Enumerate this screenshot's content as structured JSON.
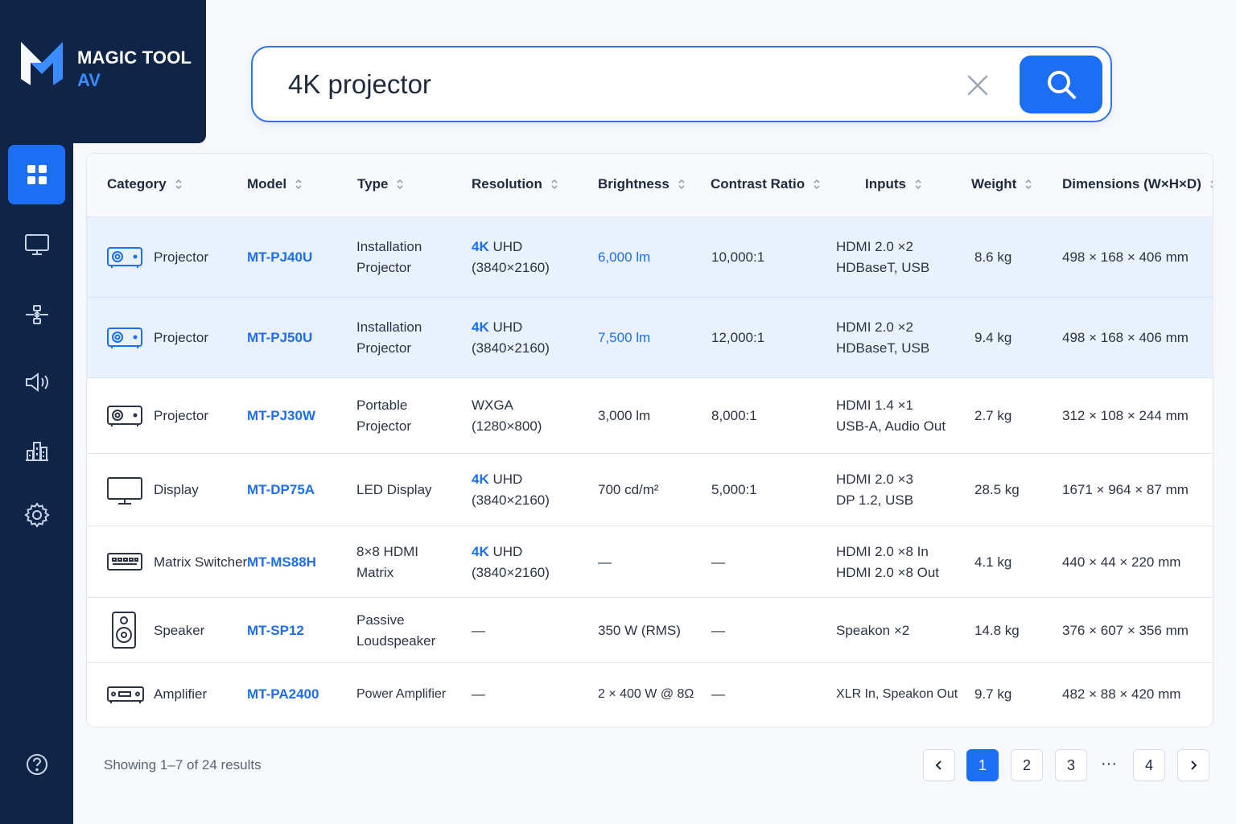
{
  "brand": {
    "name": "MAGIC TOOL",
    "sub": "AV",
    "logo_icon": "m-logo-icon",
    "accent": "#3b8cff",
    "bg": "#0f2548"
  },
  "sidebar": {
    "items": [
      {
        "name": "dashboard-icon",
        "active": true
      },
      {
        "name": "monitor-icon",
        "active": false
      },
      {
        "name": "network-icon",
        "active": false
      },
      {
        "name": "speaker-volume-icon",
        "active": false
      },
      {
        "name": "building-icon",
        "active": false
      },
      {
        "name": "settings-gear-icon",
        "active": false
      }
    ],
    "help_icon": "help-icon"
  },
  "search": {
    "value": "4K projector",
    "clear_icon": "close-icon",
    "button_icon": "search-icon",
    "accent": "#1c6ef2"
  },
  "table": {
    "columns": [
      "Category",
      "Model",
      "Type",
      "Resolution",
      "Brightness",
      "Contrast Ratio",
      "Inputs",
      "Weight",
      "Dimensions (W×H×D)"
    ],
    "rows": [
      {
        "icon": "projector-icon",
        "category": "Projector",
        "model": "MT-PJ40U",
        "type": [
          "Installation",
          "Projector"
        ],
        "res_prefix": "4K",
        "res_1": "UHD",
        "res_2": "(3840×2160)",
        "brightness": "6,000 lm",
        "contrast": "10,000:1",
        "inputs": [
          "HDMI 2.0 ×2",
          "HDBaseT, USB"
        ],
        "weight": "8.6 kg",
        "dimensions": "498 × 168 × 406 mm",
        "highlighted": true
      },
      {
        "icon": "projector-icon",
        "category": "Projector",
        "model": "MT-PJ50U",
        "type": [
          "Installation",
          "Projector"
        ],
        "res_prefix": "4K",
        "res_1": "UHD",
        "res_2": "(3840×2160)",
        "brightness": "7,500 lm",
        "contrast": "12,000:1",
        "inputs": [
          "HDMI 2.0 ×2",
          "HDBaseT, USB"
        ],
        "weight": "9.4 kg",
        "dimensions": "498 × 168 × 406 mm",
        "highlighted": true
      },
      {
        "icon": "projector-icon",
        "category": "Projector",
        "model": "MT-PJ30W",
        "type": [
          "Portable",
          "Projector"
        ],
        "res_prefix": "",
        "res_1": "WXGA",
        "res_2": "(1280×800)",
        "brightness": "3,000 lm",
        "contrast": "8,000:1",
        "inputs": [
          "HDMI 1.4 ×1",
          "USB-A, Audio Out"
        ],
        "weight": "2.7 kg",
        "dimensions": "312 × 108 × 244 mm",
        "highlighted": false
      },
      {
        "icon": "display-icon",
        "category": "Display",
        "model": "MT-DP75A",
        "type": [
          "LED Display",
          ""
        ],
        "res_prefix": "4K",
        "res_1": "UHD",
        "res_2": "(3840×2160)",
        "brightness": "700 cd/m²",
        "contrast": "5,000:1",
        "inputs": [
          "HDMI 2.0 ×3",
          "DP 1.2, USB"
        ],
        "weight": "28.5 kg",
        "dimensions": "1671 × 964 × 87 mm",
        "highlighted": false
      },
      {
        "icon": "matrix-switcher-icon",
        "category": "Matrix Switcher",
        "model": "MT-MS88H",
        "type": [
          "8×8 HDMI",
          "Matrix"
        ],
        "res_prefix": "4K",
        "res_1": "UHD",
        "res_2": "(3840×2160)",
        "brightness": "—",
        "contrast": "—",
        "inputs": [
          "HDMI 2.0 ×8 In",
          "HDMI 2.0 ×8 Out"
        ],
        "weight": "4.1 kg",
        "dimensions": "440 × 44 × 220 mm",
        "highlighted": false
      },
      {
        "icon": "speaker-icon",
        "category": "Speaker",
        "model": "MT-SP12",
        "type": [
          "Passive",
          "Loudspeaker"
        ],
        "res_prefix": "",
        "res_1": "—",
        "res_2": "",
        "brightness": "350 W (RMS)",
        "contrast": "—",
        "inputs": [
          "Speakon ×2",
          ""
        ],
        "weight": "14.8 kg",
        "dimensions": "376 × 607 × 356 mm",
        "highlighted": false
      },
      {
        "icon": "amplifier-icon",
        "category": "Amplifier",
        "model": "MT-PA2400",
        "type": [
          "Power Amplifier",
          ""
        ],
        "res_prefix": "",
        "res_1": "—",
        "res_2": "",
        "brightness": "2 × 400 W @ 8Ω",
        "contrast": "—",
        "inputs": [
          "XLR In, Speakon Out",
          ""
        ],
        "weight": "9.7 kg",
        "dimensions": "482 × 88 × 420 mm",
        "highlighted": false
      }
    ]
  },
  "footer": {
    "showing": "Showing 1–7 of 24 results",
    "pages": [
      "1",
      "2",
      "3",
      "4"
    ],
    "ellipsis": "···",
    "current_page": "1",
    "prev_icon": "chevron-left-icon",
    "next_icon": "chevron-right-icon"
  }
}
